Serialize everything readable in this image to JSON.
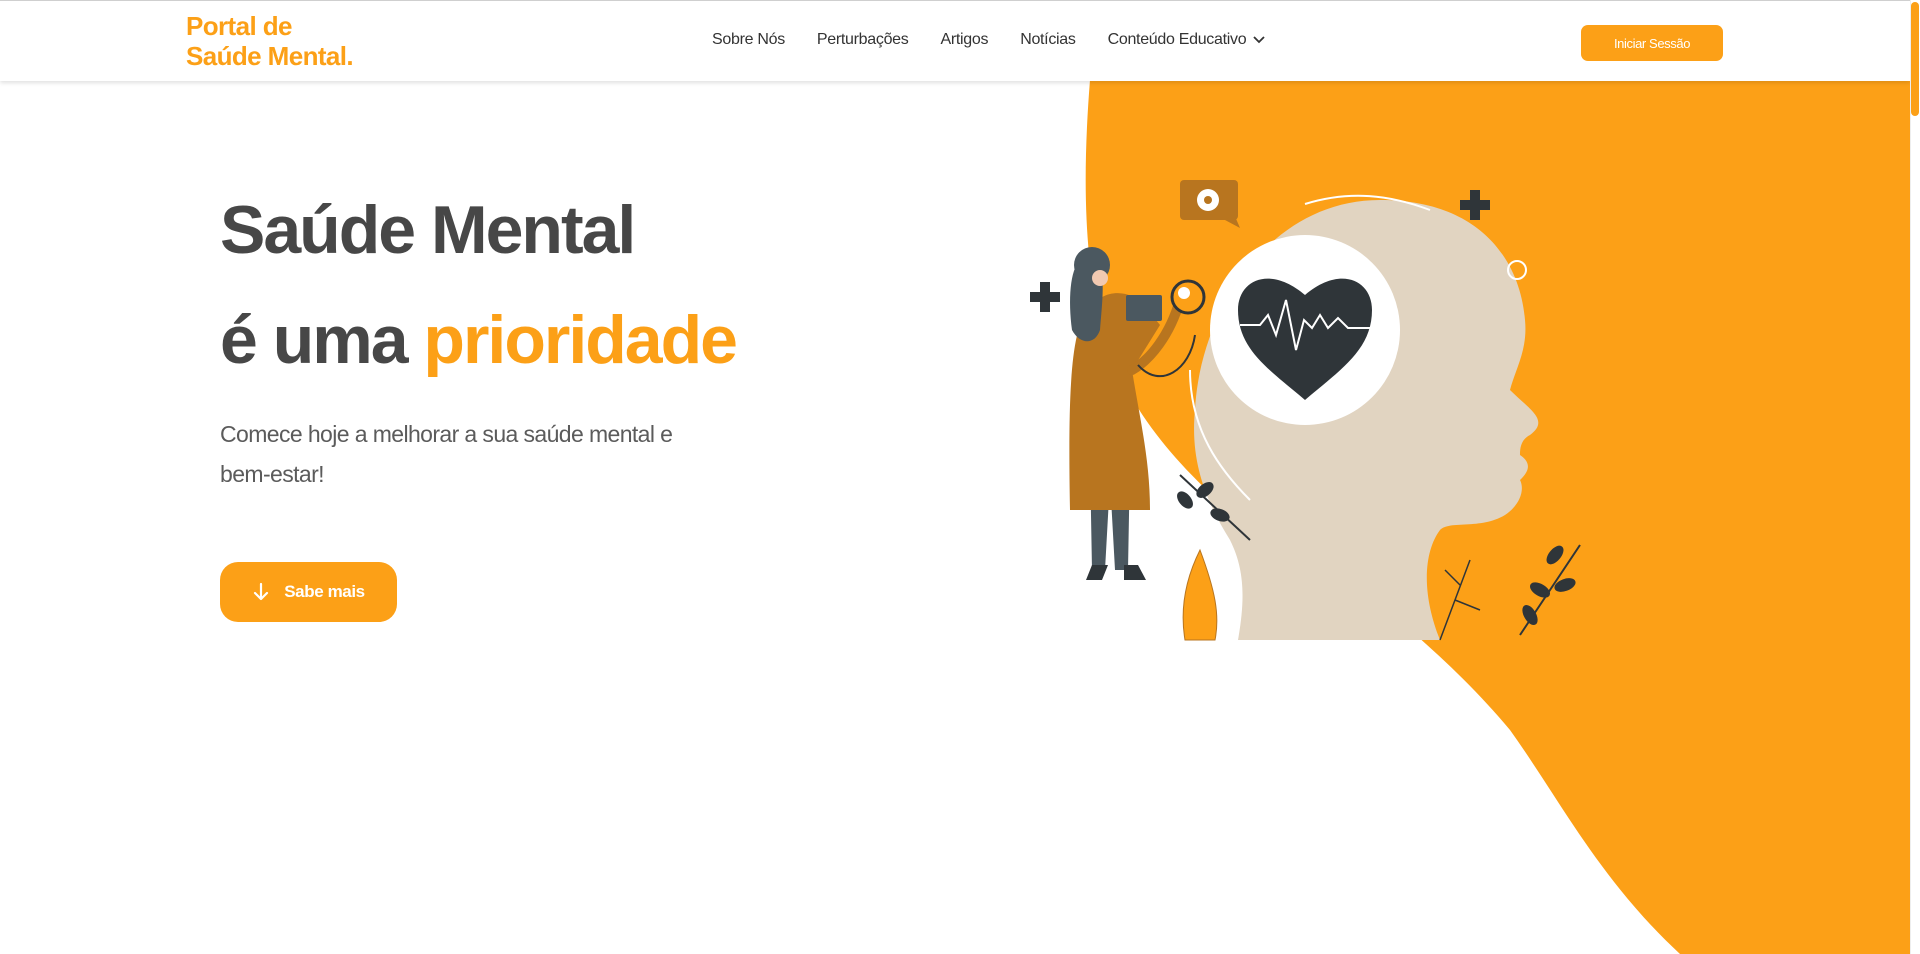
{
  "header": {
    "logo_line1": "Portal de",
    "logo_line2": "Saúde Mental.",
    "nav": [
      "Sobre Nós",
      "Perturbações",
      "Artigos",
      "Notícias",
      "Conteúdo Educativo"
    ],
    "login_label": "Iniciar Sessão"
  },
  "hero": {
    "line1": "Saúde Mental",
    "line2_prefix": "é uma ",
    "line2_accent": "prioridade",
    "subtitle": "Comece hoje a melhorar a sua saúde mental e bem-estar!",
    "cta_label": "Sabe mais"
  },
  "icons": {
    "chevron": "chevron-down-icon",
    "cta_icon": "arrow-down-icon"
  },
  "colors": {
    "accent": "#fca017",
    "text_dark": "#474747",
    "illus_dark": "#2f3539",
    "head_beige": "#e1d4c1",
    "coat_brown": "#b8751f"
  }
}
